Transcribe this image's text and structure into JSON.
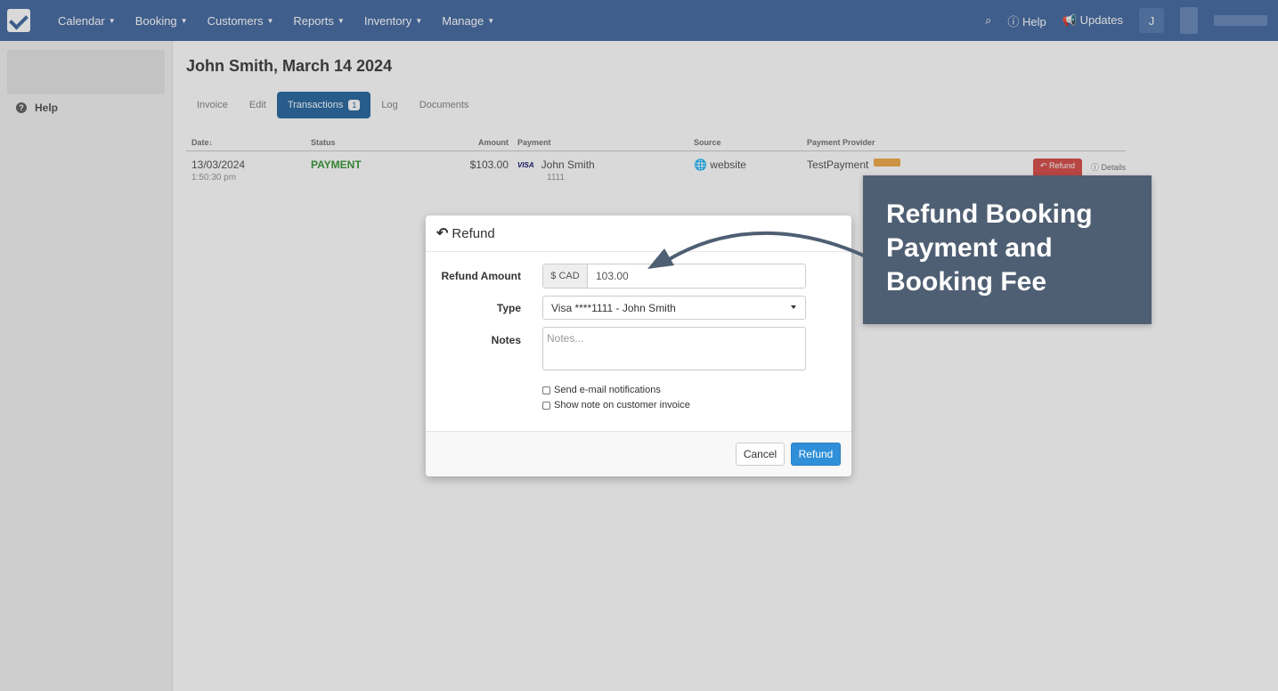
{
  "nav": {
    "menu": [
      {
        "label": "Calendar"
      },
      {
        "label": "Booking"
      },
      {
        "label": "Customers"
      },
      {
        "label": "Reports"
      },
      {
        "label": "Inventory"
      },
      {
        "label": "Manage"
      }
    ],
    "help_label": "Help",
    "updates_label": "Updates",
    "user_initial": "J"
  },
  "sidebar": {
    "help_label": "Help"
  },
  "page": {
    "title": "John Smith, March 14 2024",
    "tabs": [
      {
        "label": "Invoice"
      },
      {
        "label": "Edit"
      },
      {
        "label": "Transactions",
        "count": "1"
      },
      {
        "label": "Log"
      },
      {
        "label": "Documents"
      }
    ]
  },
  "transactions": {
    "columns": [
      "Date↓",
      "Status",
      "Amount",
      "Payment",
      "Source",
      "Payment Provider"
    ],
    "rows": [
      {
        "date": "13/03/2024",
        "time": "1:50:30 pm",
        "status": "PAYMENT",
        "amount": "$103.00",
        "card_brand": "VISA",
        "payer": "John Smith",
        "card_last4": "1111",
        "source": "website",
        "provider": "TestPayment",
        "refund_label": "Refund",
        "details_label": "Details"
      }
    ]
  },
  "modal": {
    "title": "Refund",
    "refund_amount_label": "Refund Amount",
    "currency": "$ CAD",
    "amount_value": "103.00",
    "type_label": "Type",
    "type_value": "Visa ****1111 - John Smith",
    "notes_label": "Notes",
    "notes_placeholder": "Notes...",
    "checkbox_email": "Send e-mail notifications",
    "checkbox_invoice": "Show note on customer invoice",
    "cancel_label": "Cancel",
    "refund_label": "Refund"
  },
  "callout": {
    "text": "Refund Booking Payment and Booking Fee"
  },
  "colors": {
    "nav": "#4a6fa5",
    "primary": "#2f8fd8",
    "callout": "#4f5f73"
  }
}
